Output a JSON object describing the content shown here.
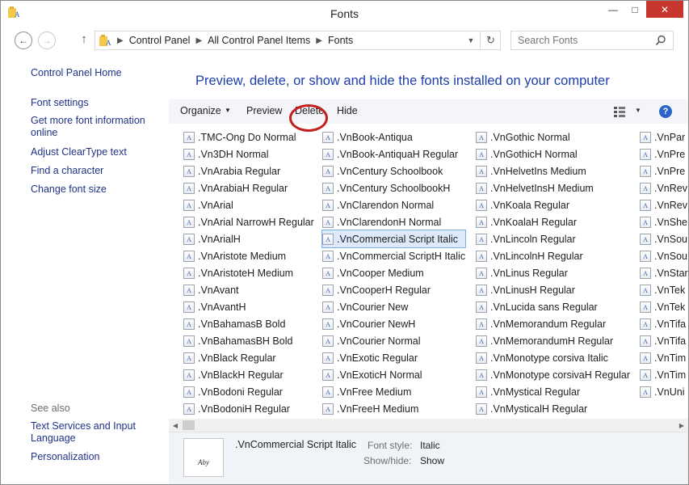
{
  "window": {
    "title": "Fonts",
    "icon": "folder-fonts-icon",
    "close_color": "#c7372f"
  },
  "address": {
    "parts": [
      "Control Panel",
      "All Control Panel Items",
      "Fonts"
    ]
  },
  "search": {
    "placeholder": "Search Fonts"
  },
  "sidebar": {
    "home": "Control Panel Home",
    "links": [
      "Font settings",
      "Get more font information online",
      "Adjust ClearType text",
      "Find a character",
      "Change font size"
    ],
    "see_also_label": "See also",
    "see_also": [
      "Text Services and Input Language",
      "Personalization"
    ]
  },
  "main": {
    "heading": "Preview, delete, or show and hide the fonts installed on your computer",
    "heading_color": "#1e3ea8"
  },
  "toolbar": {
    "organize": "Organize",
    "preview": "Preview",
    "delete": "Delete",
    "hide": "Hide",
    "highlight_color": "#c41f1f"
  },
  "fonts": {
    "col1": [
      ".TMC-Ong Do Normal",
      ".Vn3DH  Normal",
      ".VnArabia Regular",
      ".VnArabiaH Regular",
      ".VnArial",
      ".VnArial NarrowH Regular",
      ".VnArialH",
      ".VnAristote Medium",
      ".VnAristoteH Medium",
      ".VnAvant",
      ".VnAvantH",
      ".VnBahamasB Bold",
      ".VnBahamasBH Bold",
      ".VnBlack Regular",
      ".VnBlackH Regular",
      ".VnBodoni Regular",
      ".VnBodoniH Regular"
    ],
    "col2": [
      ".VnBook-Antiqua",
      ".VnBook-AntiquaH Regular",
      ".VnCentury Schoolbook",
      ".VnCentury SchoolbookH",
      ".VnClarendon Normal",
      ".VnClarendonH Normal",
      ".VnCommercial Script Italic",
      ".VnCommercial ScriptH Italic",
      ".VnCooper Medium",
      ".VnCooperH Regular",
      ".VnCourier New",
      ".VnCourier NewH",
      ".VnCourier Normal",
      ".VnExotic Regular",
      ".VnExoticH Normal",
      ".VnFree Medium",
      ".VnFreeH Medium"
    ],
    "col3": [
      ".VnGothic Normal",
      ".VnGothicH Normal",
      ".VnHelvetIns Medium",
      ".VnHelvetInsH Medium",
      ".VnKoala Regular",
      ".VnKoalaH Regular",
      ".VnLincoln Regular",
      ".VnLincolnH Regular",
      ".VnLinus Regular",
      ".VnLinusH Regular",
      ".VnLucida sans Regular",
      ".VnMemorandum Regular",
      ".VnMemorandumH Regular",
      ".VnMonotype corsiva Italic",
      ".VnMonotype corsivaH Regular",
      ".VnMystical Regular",
      ".VnMysticalH Regular"
    ],
    "col4": [
      ".VnPar",
      ".VnPre",
      ".VnPre",
      ".VnRev",
      ".VnRev",
      ".VnShe",
      ".VnSou",
      ".VnSou",
      ".VnStar",
      ".VnTek",
      ".VnTek",
      ".VnTifa",
      ".VnTifa",
      ".VnTim",
      ".VnTim",
      ".VnUni"
    ],
    "selected_col": "col2",
    "selected_index": 6
  },
  "details": {
    "name": ".VnCommercial Script Italic",
    "style_label": "Font style:",
    "style_value": "Italic",
    "showhide_label": "Show/hide:",
    "showhide_value": "Show",
    "thumb_text": "Aby"
  }
}
